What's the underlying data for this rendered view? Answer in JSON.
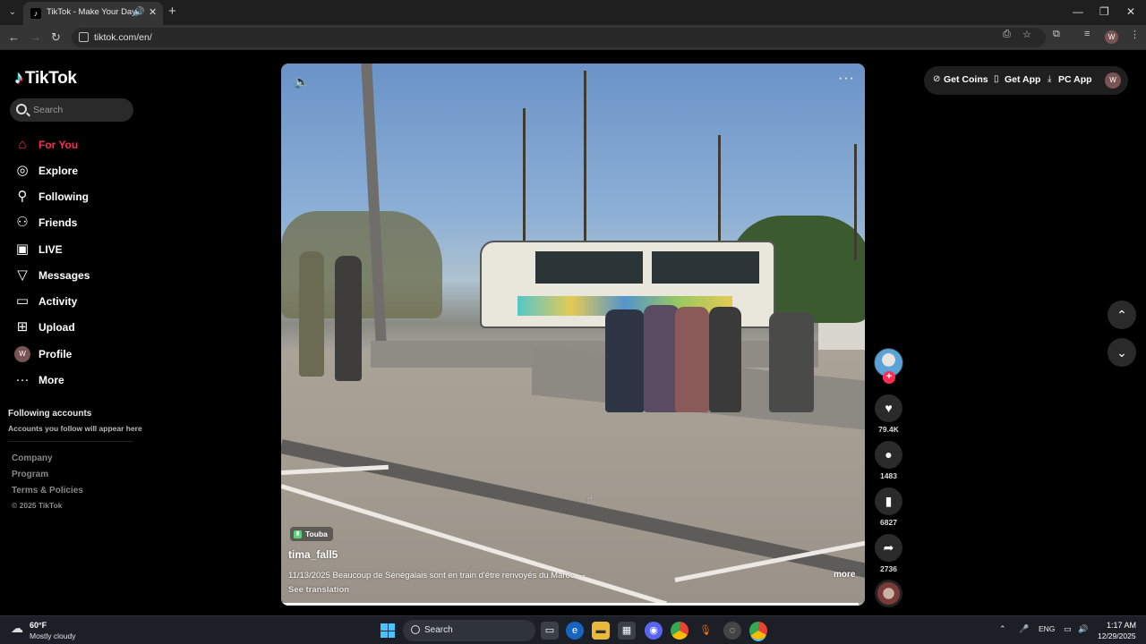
{
  "browser": {
    "tab_title": "TikTok - Make Your Day",
    "url": "tiktok.com/en/",
    "profile_initial": "W"
  },
  "sidebar": {
    "logo": "TikTok",
    "search_placeholder": "Search",
    "items": [
      {
        "label": "For You",
        "icon": "home-icon",
        "active": true
      },
      {
        "label": "Explore",
        "icon": "compass-icon"
      },
      {
        "label": "Following",
        "icon": "user-follow-icon"
      },
      {
        "label": "Friends",
        "icon": "friends-icon"
      },
      {
        "label": "LIVE",
        "icon": "live-icon"
      },
      {
        "label": "Messages",
        "icon": "send-icon"
      },
      {
        "label": "Activity",
        "icon": "message-box-icon"
      },
      {
        "label": "Upload",
        "icon": "plus-square-icon"
      },
      {
        "label": "Profile",
        "icon": "avatar",
        "initial": "W"
      },
      {
        "label": "More",
        "icon": "ellipsis-icon"
      }
    ],
    "following_title": "Following accounts",
    "following_subtitle": "Accounts you follow will appear here",
    "footer_links": [
      "Company",
      "Program",
      "Terms & Policies"
    ],
    "copyright": "© 2025 TikTok"
  },
  "video": {
    "location": "Touba",
    "author": "tima_fall5",
    "caption": "11/13/2025 Beaucoup de Sénégalais sont en train d'être renvoyés du Maroc.··-",
    "more_label": "more",
    "translation_label": "See translation",
    "progress_fraction": 0.99
  },
  "actions": {
    "likes": "79.4K",
    "comments": "1483",
    "bookmarks": "6827",
    "shares": "2736"
  },
  "topbar": {
    "get_coins": "Get Coins",
    "get_app": "Get App",
    "pc_app": "PC App",
    "avatar_initial": "W"
  },
  "taskbar": {
    "temperature": "60°F",
    "weather": "Mostly cloudy",
    "search": "Search",
    "language": "ENG",
    "time": "1:17 AM",
    "date": "12/29/2025"
  },
  "colors": {
    "accent": "#fe2c55",
    "background": "#000000",
    "button_bg": "#2a2a2a"
  }
}
